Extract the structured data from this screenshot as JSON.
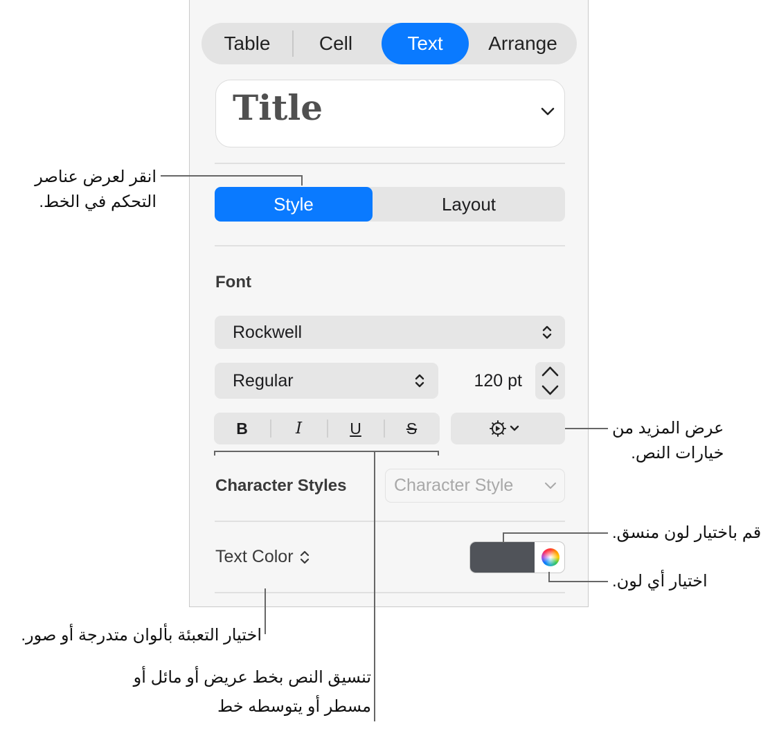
{
  "inspector_tabs": [
    "Table",
    "Cell",
    "Text",
    "Arrange"
  ],
  "active_tab": "Text",
  "paragraph_style": "Title",
  "sub_tabs": [
    "Style",
    "Layout"
  ],
  "active_sub_tab": "Style",
  "font": {
    "section_label": "Font",
    "family": "Rockwell",
    "typeface": "Regular",
    "size": "120 pt",
    "format_buttons": [
      "B",
      "I",
      "U",
      "S"
    ]
  },
  "character_styles": {
    "label": "Character Styles",
    "placeholder": "Character Style"
  },
  "text_color": {
    "label": "Text Color",
    "swatch_color": "#505359"
  },
  "accent_color": "#0a7aff",
  "callouts": {
    "font_controls_line1": "انقر لعرض عناصر",
    "font_controls_line2": "التحكم في الخط.",
    "more_options_line1": "عرض المزيد من",
    "more_options_line2": "خيارات النص.",
    "matching_color": "قم باختيار لون منسق.",
    "any_color": "اختيار أي لون.",
    "fill_options": "اختيار التعبئة بألوان متدرجة أو صور.",
    "format_line1": "تنسيق النص بخط عريض أو مائل أو",
    "format_line2": "مسطر أو يتوسطه خط"
  }
}
